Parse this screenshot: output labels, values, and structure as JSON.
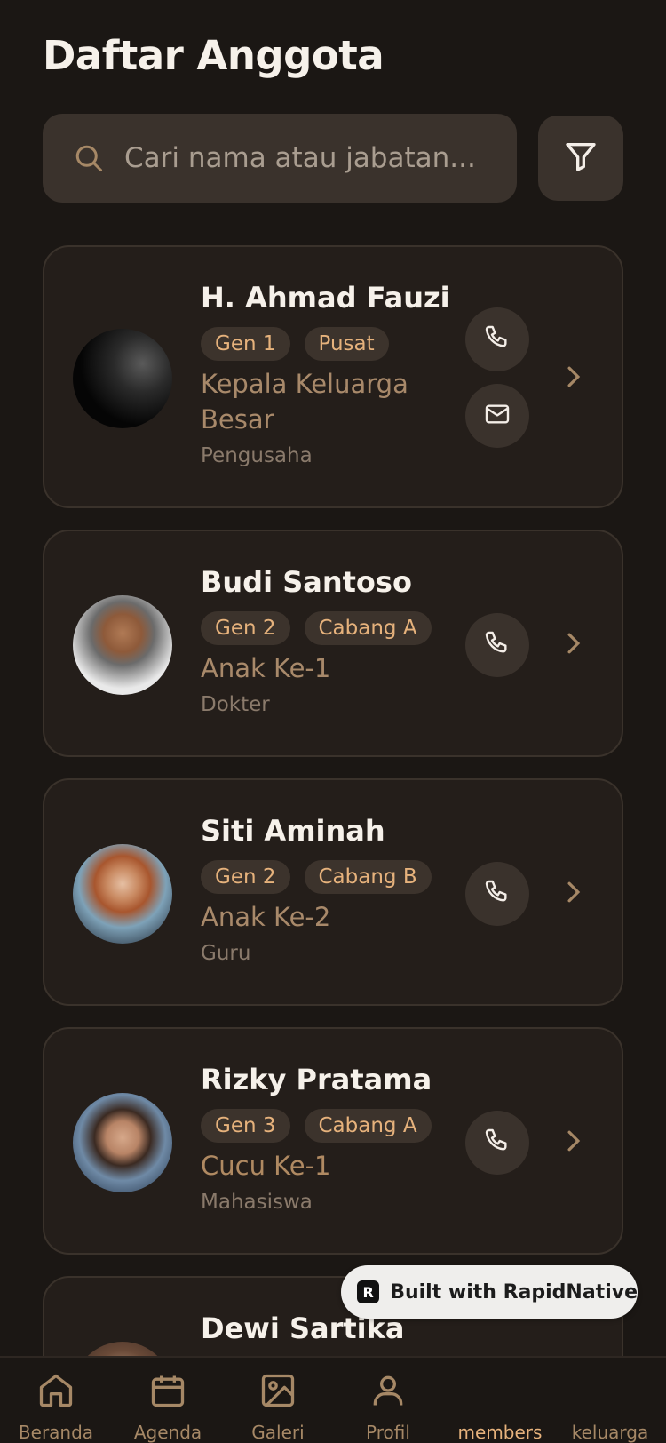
{
  "page": {
    "title": "Daftar Anggota"
  },
  "search": {
    "placeholder": "Cari nama atau jabatan..."
  },
  "members": [
    {
      "name": "H. Ahmad Fauzi",
      "generation": "Gen 1",
      "branch": "Pusat",
      "role": "Kepala Keluarga Besar",
      "occupation": "Pengusaha"
    },
    {
      "name": "Budi Santoso",
      "generation": "Gen 2",
      "branch": "Cabang A",
      "role": "Anak Ke-1",
      "occupation": "Dokter"
    },
    {
      "name": "Siti Aminah",
      "generation": "Gen 2",
      "branch": "Cabang B",
      "role": "Anak Ke-2",
      "occupation": "Guru"
    },
    {
      "name": "Rizky Pratama",
      "generation": "Gen 3",
      "branch": "Cabang A",
      "role": "Cucu Ke-1",
      "occupation": "Mahasiswa"
    },
    {
      "name": "Dewi Sartika"
    }
  ],
  "badge": {
    "logo": "R",
    "text": "Built with RapidNative"
  },
  "tabs": [
    {
      "label": "Beranda",
      "icon": "home-icon"
    },
    {
      "label": "Agenda",
      "icon": "calendar-icon"
    },
    {
      "label": "Galeri",
      "icon": "image-icon"
    },
    {
      "label": "Profil",
      "icon": "user-icon"
    },
    {
      "label": "members",
      "active": true
    },
    {
      "label": "keluarga"
    }
  ],
  "colors": {
    "background": "#1b1714",
    "card": "#241e1a",
    "accent": "#e6b27c",
    "chip_bg": "#3c332c",
    "muted": "#a8896a"
  }
}
